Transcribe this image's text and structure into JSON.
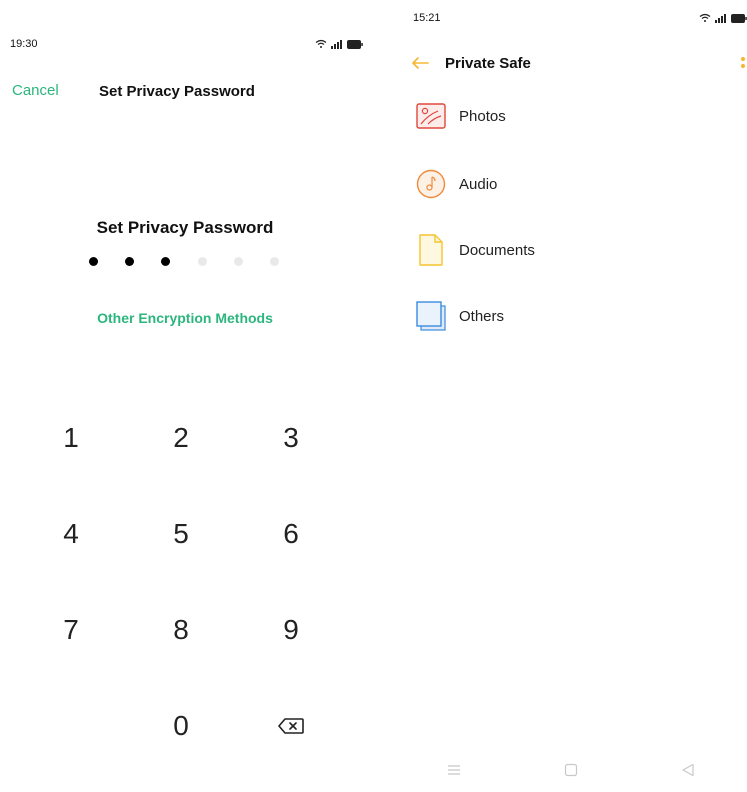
{
  "left_screen": {
    "status": {
      "time": "19:30"
    },
    "topbar": {
      "cancel": "Cancel",
      "title": "Set Privacy Password"
    },
    "password": {
      "title": "Set Privacy Password",
      "filled": 3,
      "total": 6
    },
    "other_methods": "Other Encryption Methods",
    "keypad": {
      "keys": [
        "1",
        "2",
        "3",
        "4",
        "5",
        "6",
        "7",
        "8",
        "9",
        "",
        "0",
        "⌫"
      ]
    }
  },
  "right_screen": {
    "status": {
      "time": "15:21"
    },
    "header": {
      "title": "Private Safe"
    },
    "items": [
      {
        "label": "Photos",
        "icon": "photos-icon",
        "color": "#e0473c"
      },
      {
        "label": "Audio",
        "icon": "audio-icon",
        "color": "#f08a3c"
      },
      {
        "label": "Documents",
        "icon": "document-icon",
        "color": "#f5c431"
      },
      {
        "label": "Others",
        "icon": "others-icon",
        "color": "#3b8ce0"
      }
    ]
  },
  "colors": {
    "accent": "#2cb67d",
    "arrow": "#f5b731"
  }
}
